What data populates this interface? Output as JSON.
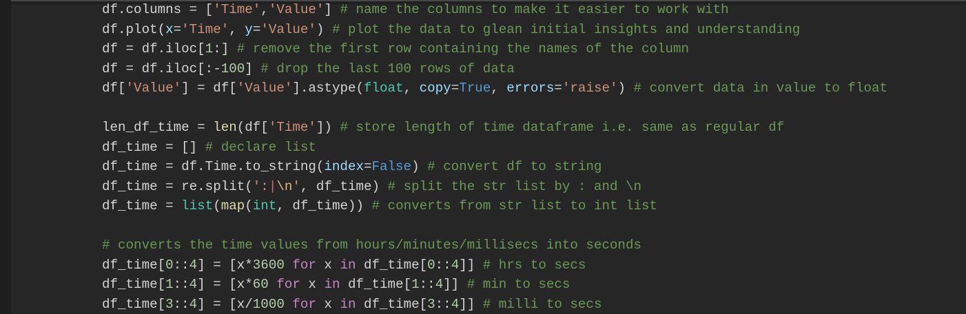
{
  "editor": {
    "lines": [
      [
        [
          "df.columns = [",
          "p"
        ],
        [
          "'Time'",
          "s"
        ],
        [
          ",",
          "p"
        ],
        [
          "'Value'",
          "s"
        ],
        [
          "] ",
          "p"
        ],
        [
          "# name the columns to make it easier to work with",
          "c"
        ]
      ],
      [
        [
          "df.plot(",
          "p"
        ],
        [
          "x",
          "v"
        ],
        [
          "=",
          "p"
        ],
        [
          "'Time'",
          "s"
        ],
        [
          ", ",
          "p"
        ],
        [
          "y",
          "v"
        ],
        [
          "=",
          "p"
        ],
        [
          "'Value'",
          "s"
        ],
        [
          ") ",
          "p"
        ],
        [
          "# plot the data to glean initial insights and understanding",
          "c"
        ]
      ],
      [
        [
          "df = df.iloc[",
          "p"
        ],
        [
          "1",
          "n"
        ],
        [
          ":] ",
          "p"
        ],
        [
          "# remove the first row containing the names of the column",
          "c"
        ]
      ],
      [
        [
          "df = df.iloc[:-",
          "p"
        ],
        [
          "100",
          "n"
        ],
        [
          "] ",
          "p"
        ],
        [
          "# drop the last 100 rows of data",
          "c"
        ]
      ],
      [
        [
          "df[",
          "p"
        ],
        [
          "'Value'",
          "s"
        ],
        [
          "] = df[",
          "p"
        ],
        [
          "'Value'",
          "s"
        ],
        [
          "].astype(",
          "p"
        ],
        [
          "float",
          "b"
        ],
        [
          ", ",
          "p"
        ],
        [
          "copy",
          "v"
        ],
        [
          "=",
          "p"
        ],
        [
          "True",
          "k"
        ],
        [
          ", ",
          "p"
        ],
        [
          "errors",
          "v"
        ],
        [
          "=",
          "p"
        ],
        [
          "'raise'",
          "s"
        ],
        [
          ") ",
          "p"
        ],
        [
          "# convert data in value to float",
          "c"
        ]
      ],
      [],
      [
        [
          "len_df_time = ",
          "p"
        ],
        [
          "len",
          "f"
        ],
        [
          "(df[",
          "p"
        ],
        [
          "'Time'",
          "s"
        ],
        [
          "]) ",
          "p"
        ],
        [
          "# store length of time dataframe i.e. same as regular df",
          "c"
        ]
      ],
      [
        [
          "df_time = [] ",
          "p"
        ],
        [
          "# declare list",
          "c"
        ]
      ],
      [
        [
          "df_time = df.Time.to_string(",
          "p"
        ],
        [
          "index",
          "v"
        ],
        [
          "=",
          "p"
        ],
        [
          "False",
          "k"
        ],
        [
          ") ",
          "p"
        ],
        [
          "# convert df to string",
          "c"
        ]
      ],
      [
        [
          "df_time = re.split(",
          "p"
        ],
        [
          "':",
          "s"
        ],
        [
          "|",
          "r"
        ],
        [
          "\\n",
          "e"
        ],
        [
          "'",
          "s"
        ],
        [
          ", df_time) ",
          "p"
        ],
        [
          "# split the str list by : and \\n",
          "c"
        ]
      ],
      [
        [
          "df_time = ",
          "p"
        ],
        [
          "list",
          "b"
        ],
        [
          "(",
          "p"
        ],
        [
          "map",
          "f"
        ],
        [
          "(",
          "p"
        ],
        [
          "int",
          "b"
        ],
        [
          ", df_time)) ",
          "p"
        ],
        [
          "# converts from str list to int list",
          "c"
        ]
      ],
      [],
      [
        [
          "# converts the time values from hours/minutes/millisecs into seconds",
          "c"
        ]
      ],
      [
        [
          "df_time[",
          "p"
        ],
        [
          "0",
          "n"
        ],
        [
          "::",
          "p"
        ],
        [
          "4",
          "n"
        ],
        [
          "] = [x*",
          "p"
        ],
        [
          "3600",
          "n"
        ],
        [
          " ",
          "p"
        ],
        [
          "for",
          "kw"
        ],
        [
          " x ",
          "p"
        ],
        [
          "in",
          "kw"
        ],
        [
          " df_time[",
          "p"
        ],
        [
          "0",
          "n"
        ],
        [
          "::",
          "p"
        ],
        [
          "4",
          "n"
        ],
        [
          "]] ",
          "p"
        ],
        [
          "# hrs to secs",
          "c"
        ]
      ],
      [
        [
          "df_time[",
          "p"
        ],
        [
          "1",
          "n"
        ],
        [
          "::",
          "p"
        ],
        [
          "4",
          "n"
        ],
        [
          "] = [x*",
          "p"
        ],
        [
          "60",
          "n"
        ],
        [
          " ",
          "p"
        ],
        [
          "for",
          "kw"
        ],
        [
          " x ",
          "p"
        ],
        [
          "in",
          "kw"
        ],
        [
          " df_time[",
          "p"
        ],
        [
          "1",
          "n"
        ],
        [
          "::",
          "p"
        ],
        [
          "4",
          "n"
        ],
        [
          "]] ",
          "p"
        ],
        [
          "# min to secs",
          "c"
        ]
      ],
      [
        [
          "df_time[",
          "p"
        ],
        [
          "3",
          "n"
        ],
        [
          "::",
          "p"
        ],
        [
          "4",
          "n"
        ],
        [
          "] = [x/",
          "p"
        ],
        [
          "1000",
          "n"
        ],
        [
          " ",
          "p"
        ],
        [
          "for",
          "kw"
        ],
        [
          " x ",
          "p"
        ],
        [
          "in",
          "kw"
        ],
        [
          " df_time[",
          "p"
        ],
        [
          "3",
          "n"
        ],
        [
          "::",
          "p"
        ],
        [
          "4",
          "n"
        ],
        [
          "]] ",
          "p"
        ],
        [
          "# milli to secs",
          "c"
        ]
      ]
    ]
  }
}
